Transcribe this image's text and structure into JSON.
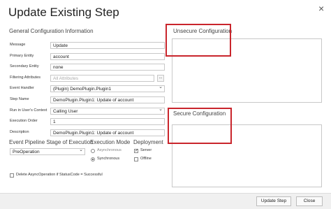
{
  "dialog": {
    "title": "Update Existing Step",
    "close_glyph": "×"
  },
  "general": {
    "heading": "General Configuration Information",
    "fields": [
      {
        "label": "Message",
        "value": "Update",
        "kind": "text"
      },
      {
        "label": "Primary Entity",
        "value": "account",
        "kind": "text"
      },
      {
        "label": "Secondary Entity",
        "value": "none",
        "kind": "text"
      },
      {
        "label": "Filtering Attributes",
        "value": "All Attributes",
        "kind": "text",
        "placeholder": true,
        "button": "..."
      },
      {
        "label": "Event Handler",
        "value": "(Plugin) DemoPlugin.Plugin1",
        "kind": "select"
      },
      {
        "label": "Step Name",
        "value": "DemoPlugin.Plugin1: Update of account",
        "kind": "text"
      },
      {
        "label": "Run in User's Context",
        "value": "Calling User",
        "kind": "select"
      },
      {
        "label": "Execution Order",
        "value": "1",
        "kind": "text"
      },
      {
        "label": "Description",
        "value": "DemoPlugin.Plugin1: Update of account",
        "kind": "text"
      }
    ]
  },
  "pipeline": {
    "heading": "Event Pipeline Stage of Execution",
    "value": "PreOperation"
  },
  "execution_mode": {
    "heading": "Execution Mode",
    "options": [
      {
        "label": "Asynchronous",
        "selected": false,
        "disabled": true
      },
      {
        "label": "Synchronous",
        "selected": true,
        "disabled": false
      }
    ]
  },
  "deployment": {
    "heading": "Deployment",
    "options": [
      {
        "label": "Server",
        "checked": true,
        "disabled": false
      },
      {
        "label": "Offline",
        "checked": false,
        "disabled": false
      }
    ]
  },
  "delete_async": {
    "label": "Delete AsyncOperation if StatusCode = Successful",
    "checked": false
  },
  "unsecure": {
    "heading": "Unsecure  Configuration",
    "value": ""
  },
  "secure": {
    "heading": "Secure  Configuration",
    "value": ""
  },
  "footer": {
    "update_label": "Update Step",
    "close_label": "Close"
  },
  "colors": {
    "highlight": "#c9252c",
    "footer_bg": "#f0f0f0"
  }
}
